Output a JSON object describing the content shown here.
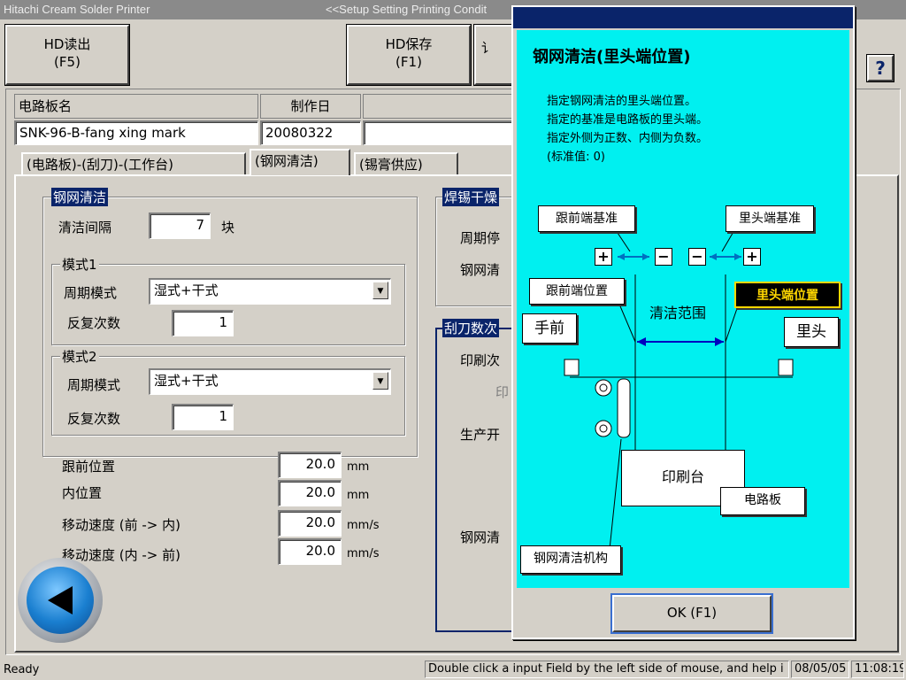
{
  "window": {
    "app_title": "Hitachi Cream Solder Printer",
    "screen_title": "<<Setup Setting Printing Condit"
  },
  "toolbar": {
    "hd_read": {
      "line1": "HD读出",
      "line2": "(F5)"
    },
    "hd_save": {
      "line1": "HD保存",
      "line2": "(F1)"
    },
    "partial_btn": "讠",
    "help": "?"
  },
  "board": {
    "name_label": "电路板名",
    "name_value": "SNK-96-B-fang xing mark",
    "date_label": "制作日",
    "date_value": "20080322"
  },
  "tabs": [
    "(电路板)-(刮刀)-(工作台)",
    "(钢网清洁)",
    "(锡膏供应)"
  ],
  "clean": {
    "group_title": "钢网清洁",
    "interval_label": "清洁间隔",
    "interval_value": "7",
    "interval_unit": "块",
    "mode1": {
      "title": "模式1",
      "cycle_label": "周期模式",
      "cycle_value": "湿式+干式",
      "repeat_label": "反复次数",
      "repeat_value": "1"
    },
    "mode2": {
      "title": "模式2",
      "cycle_label": "周期模式",
      "cycle_value": "湿式+干式",
      "repeat_label": "反复次数",
      "repeat_value": "1"
    },
    "params": [
      {
        "label": "跟前位置",
        "value": "20.0",
        "unit": "mm"
      },
      {
        "label": "内位置",
        "value": "20.0",
        "unit": "mm"
      },
      {
        "label": "移动速度 (前  -> 内)",
        "value": "20.0",
        "unit": "mm/s"
      },
      {
        "label": "移动速度 (内  -> 前)",
        "value": "20.0",
        "unit": "mm/s"
      }
    ]
  },
  "right": {
    "g1_title": "焊锡干燥",
    "g1_r1": "周期停",
    "g1_r2": "钢网清",
    "g2_title": "刮刀数次",
    "g2_r1": "印刷次",
    "g2_r2": "印",
    "g2_r3": "生产开",
    "g2_r4": "钢网清"
  },
  "dialog": {
    "heading": "钢网清洁(里头端位置)",
    "desc": [
      "指定钢网清洁的里头端位置。",
      "指定的基准是电路板的里头端。",
      "指定外侧为正数、内侧为负数。",
      "(标准值: 0)"
    ],
    "diagram": {
      "front_ref": "跟前端基准",
      "back_ref": "里头端基准",
      "plus": "+",
      "minus": "−",
      "front_pos": "跟前端位置",
      "back_pos": "里头端位置",
      "clean_range": "清洁范围",
      "front": "手前",
      "back": "里头",
      "table": "印刷台",
      "board": "电路板",
      "mechanism": "钢网清洁机构"
    },
    "ok": "OK (F1)"
  },
  "status": {
    "ready": "Ready",
    "hint": "Double click a input Field by the left side of mouse, and help i",
    "date": "08/05/05",
    "time": "11:08:19"
  },
  "colors": {
    "title_blue": "#0a246a",
    "diagram_bg": "#00f0f0",
    "board_green": "#00c000",
    "arrow": "#0070c0"
  }
}
